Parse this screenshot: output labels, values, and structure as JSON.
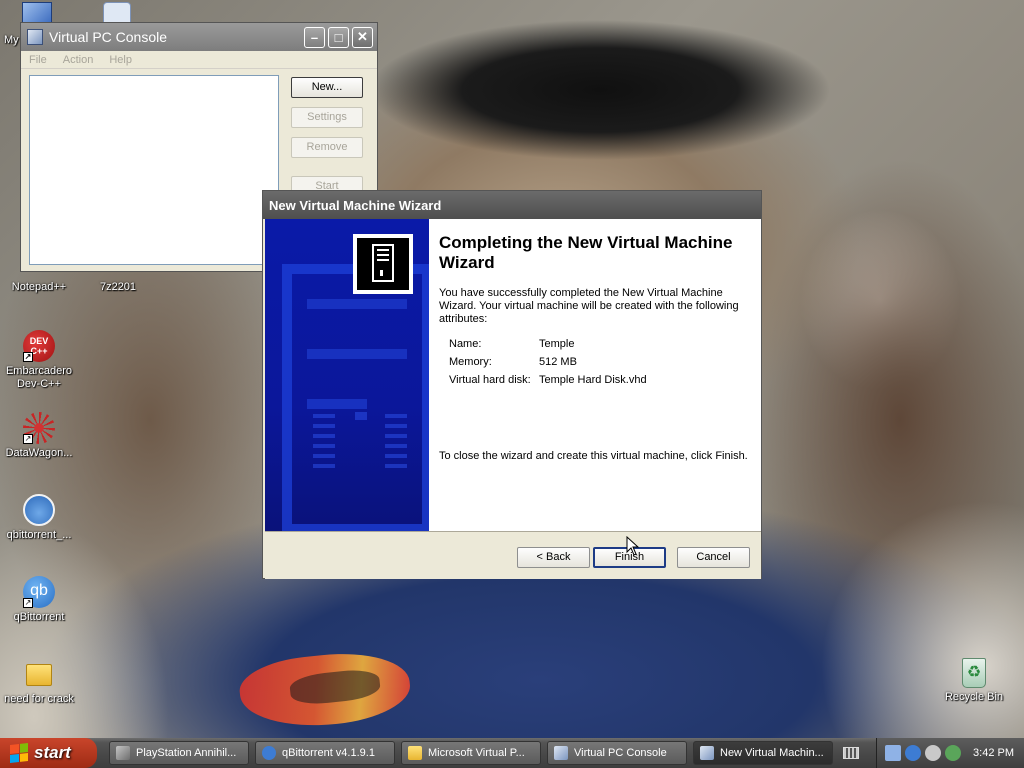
{
  "desktop": {
    "icons": [
      {
        "label": "My",
        "icon": "my-computer-icon"
      },
      {
        "label": "Notepad++",
        "icon": "notepadpp-icon"
      },
      {
        "label": "7z2201",
        "icon": "7zip-icon"
      },
      {
        "label": "Embarcadero Dev-C++",
        "icon": "devcpp-icon",
        "badge": "DEV C++"
      },
      {
        "label": "DataWagon...",
        "icon": "datawagon-icon"
      },
      {
        "label": "qbittorrent_...",
        "icon": "installer-icon"
      },
      {
        "label": "qBittorrent",
        "icon": "qbittorrent-icon",
        "badge": "qb"
      },
      {
        "label": "need for crack",
        "icon": "folder-icon"
      },
      {
        "label": "Recycle Bin",
        "icon": "recycle-bin-icon"
      }
    ]
  },
  "vpc_console": {
    "title": "Virtual PC Console",
    "menu": [
      "File",
      "Action",
      "Help"
    ],
    "buttons": {
      "new": "New...",
      "settings": "Settings",
      "remove": "Remove",
      "start": "Start"
    }
  },
  "wizard": {
    "title": "New Virtual Machine Wizard",
    "heading": "Completing the New Virtual Machine Wizard",
    "intro": "You have successfully completed the New Virtual Machine Wizard. Your virtual machine will be created with the following attributes:",
    "attributes": [
      {
        "label": "Name:",
        "value": "Temple"
      },
      {
        "label": "Memory:",
        "value": "512 MB"
      },
      {
        "label": "Virtual hard disk:",
        "value": "Temple Hard Disk.vhd"
      }
    ],
    "closing": "To close the wizard and create this virtual machine, click Finish.",
    "buttons": {
      "back": "< Back",
      "finish": "Finish",
      "cancel": "Cancel"
    }
  },
  "taskbar": {
    "start_label": "start",
    "tasks": [
      {
        "label": "PlayStation Annihil...",
        "icon": "playstation-icon",
        "active": false
      },
      {
        "label": "qBittorrent v4.1.9.1",
        "icon": "qbittorrent-icon",
        "active": false
      },
      {
        "label": "Microsoft Virtual P...",
        "icon": "folder-icon",
        "active": false
      },
      {
        "label": "Virtual PC Console",
        "icon": "virtual-pc-icon",
        "active": false
      },
      {
        "label": "New Virtual Machin...",
        "icon": "virtual-pc-icon",
        "active": true
      }
    ],
    "clock": "3:42 PM"
  },
  "colors": {
    "wizard_side": "#0b179a",
    "taskbar": "#474747",
    "start": "#b23a20"
  }
}
